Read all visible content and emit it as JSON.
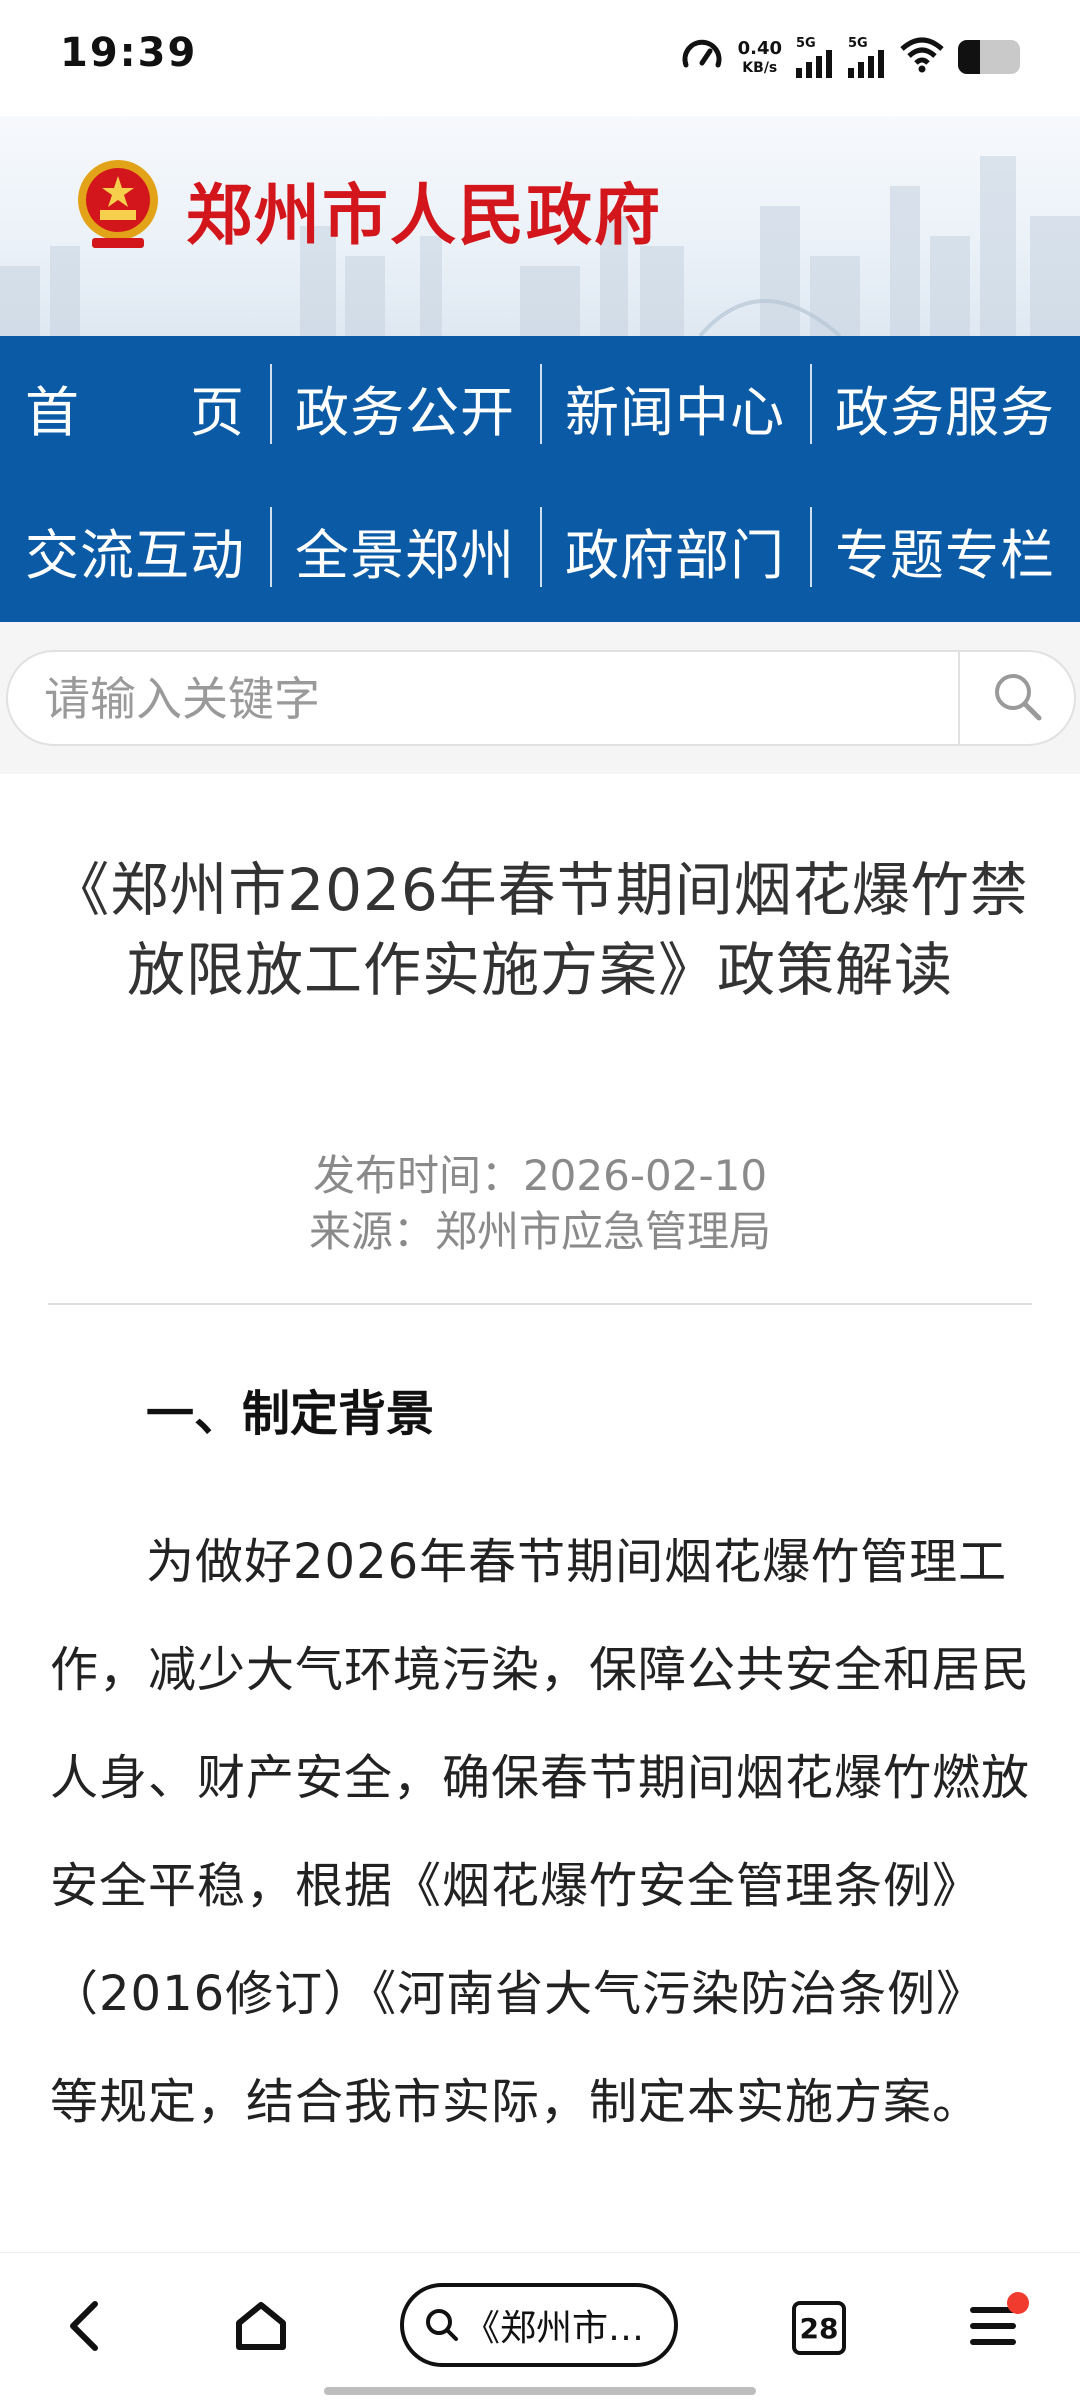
{
  "status_bar": {
    "time": "19:39",
    "net_speed_value": "0.40",
    "net_speed_unit": "KB/s",
    "signal1_label": "5G",
    "signal2_label": "5G",
    "battery_level": 0.35,
    "icons": [
      "speedometer-icon",
      "signal-icon",
      "signal-icon",
      "wifi-icon",
      "battery-icon"
    ]
  },
  "header": {
    "site_title": "郑州市人民政府",
    "title_color": "#d2161b",
    "emblem_icon": "national-emblem-icon"
  },
  "nav": {
    "bg_color": "#0a5aa6",
    "row1": [
      "首　　页",
      "政务公开",
      "新闻中心",
      "政务服务"
    ],
    "row2": [
      "交流互动",
      "全景郑州",
      "政府部门",
      "专题专栏"
    ]
  },
  "search": {
    "placeholder": "请输入关键字",
    "button_icon": "search-icon"
  },
  "article": {
    "title": "《郑州市2026年春节期间烟花爆竹禁放限放工作实施方案》政策解读",
    "publish_time": "发布时间：2026-02-10",
    "source": "来源：郑州市应急管理局",
    "section_heading": "一、制定背景",
    "paragraph": "为做好2026年春节期间烟花爆竹管理工作，减少大气环境污染，保障公共安全和居民人身、财产安全，确保春节期间烟花爆竹燃放安全平稳，根据《烟花爆竹安全管理条例》（2016修订）《河南省大气污染防治条例》等规定，结合我市实际，制定本实施方案。"
  },
  "bottom_bar": {
    "back_icon": "back-arrow-icon",
    "home_icon": "home-icon",
    "url_text": "《郑州市…",
    "url_icon": "search-icon",
    "tab_count": "28",
    "menu_icon": "menu-icon",
    "notification_color": "#f23b2f"
  }
}
